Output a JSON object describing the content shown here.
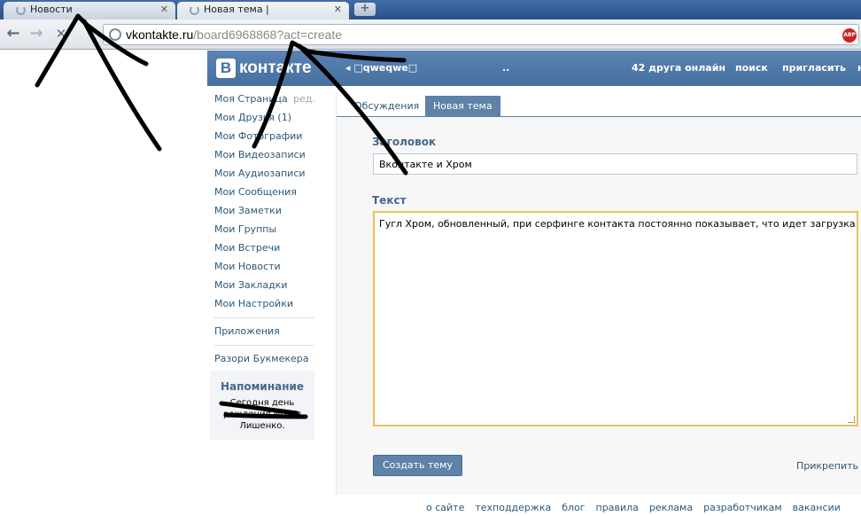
{
  "browser": {
    "tabs": [
      {
        "label": "Новости"
      },
      {
        "label": "Новая тема | □qweqwe□"
      }
    ],
    "new_tab_glyph": "+",
    "address_host": "vkontakte.ru",
    "address_path": "/board6968868?act=create",
    "extension_badge": "ABP",
    "back_glyph": "←",
    "forward_glyph": "→",
    "stop_glyph": "✕"
  },
  "vk_header": {
    "logo_letter": "В",
    "logo_text": "контакте",
    "group_link": "◂ □qweqwe□",
    "dots": "..",
    "friends_online": "42 друга онлайн",
    "search": "поиск",
    "invite": "пригласить",
    "more": "н"
  },
  "left_menu": {
    "items": [
      {
        "label": "Моя Страница",
        "edit": "ред."
      },
      {
        "label": "Мои Друзья (1)"
      },
      {
        "label": "Мои Фотографии"
      },
      {
        "label": "Мои Видеозаписи"
      },
      {
        "label": "Мои Аудиозаписи"
      },
      {
        "label": "Мои Сообщения"
      },
      {
        "label": "Мои Заметки"
      },
      {
        "label": "Мои Группы"
      },
      {
        "label": "Мои Встречи"
      },
      {
        "label": "Мои Новости"
      },
      {
        "label": "Мои Закладки"
      },
      {
        "label": "Мои Настройки"
      }
    ],
    "apps": "Приложения",
    "promo": "Разори Букмекера",
    "reminder_title": "Напоминание",
    "reminder_body": "Сегодня день рождения Игоря Лишенко."
  },
  "content": {
    "tabs": [
      {
        "label": "Обсуждения"
      },
      {
        "label": "Новая тема"
      }
    ],
    "title_label": "Заголовок",
    "title_value": "Вконтакте и Хром",
    "text_label": "Текст",
    "text_value": "Гугл Хром, обновленный, при серфинге контакта постоянно показывает, что идет загрузка:|",
    "create_button": "Создать тему",
    "pin_link": "Прикрепить"
  },
  "footer": {
    "links": [
      "о сайте",
      "техподдержка",
      "блог",
      "правила",
      "реклама",
      "разработчикам",
      "вакансии"
    ]
  },
  "colors": {
    "vk_blue": "#45688e",
    "header_blue": "#4a76a8",
    "textarea_focus": "#e8c25a",
    "abp_red": "#cc2222"
  },
  "icons": [
    "loading-spinner-icon",
    "back-arrow-icon",
    "forward-arrow-icon",
    "stop-icon",
    "globe-icon",
    "adblock-icon",
    "new-tab-icon"
  ]
}
